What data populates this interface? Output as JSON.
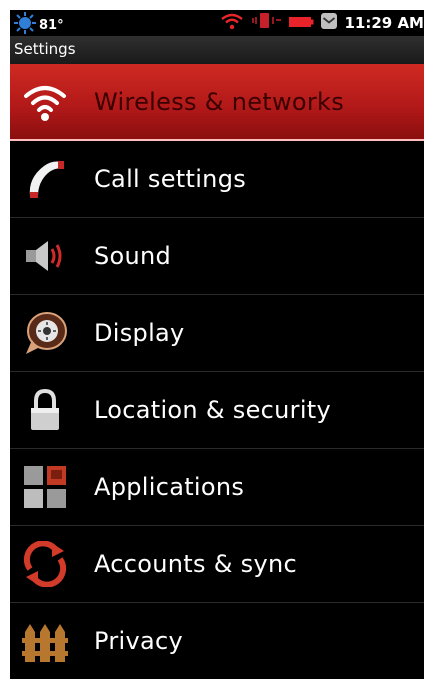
{
  "status_bar": {
    "temperature": "81°",
    "time": "11:29 AM"
  },
  "title_bar": {
    "title": "Settings"
  },
  "settings_items": [
    {
      "label": "Wireless & networks",
      "icon": "wifi-icon",
      "selected": true
    },
    {
      "label": "Call settings",
      "icon": "phone-handset-icon",
      "selected": false
    },
    {
      "label": "Sound",
      "icon": "speaker-icon",
      "selected": false
    },
    {
      "label": "Display",
      "icon": "brightness-icon",
      "selected": false
    },
    {
      "label": "Location & security",
      "icon": "padlock-icon",
      "selected": false
    },
    {
      "label": "Applications",
      "icon": "apps-grid-icon",
      "selected": false
    },
    {
      "label": "Accounts & sync",
      "icon": "sync-icon",
      "selected": false
    },
    {
      "label": "Privacy",
      "icon": "privacy-icon",
      "selected": false
    }
  ],
  "colors": {
    "selected_row": "#c41f1a",
    "background": "#000000",
    "text": "#ffffff"
  }
}
